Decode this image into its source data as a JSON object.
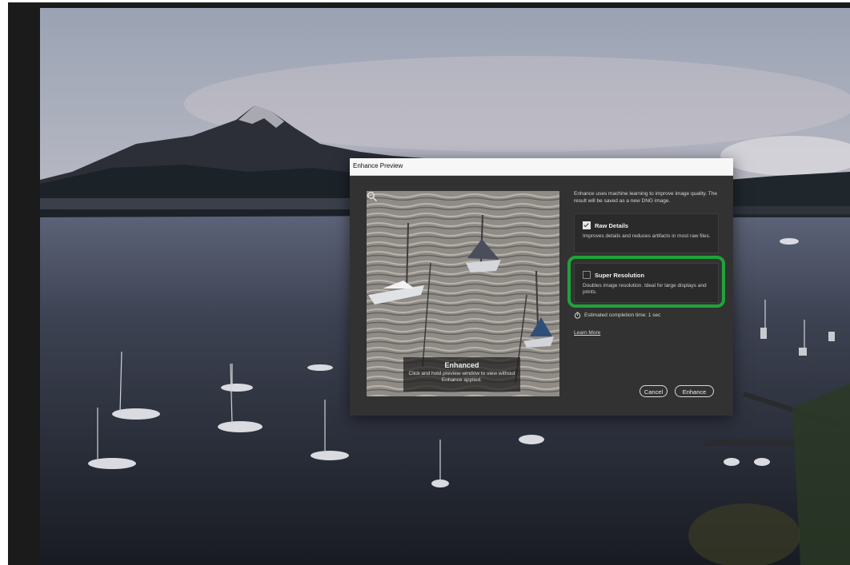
{
  "dialog": {
    "title": "Enhance Preview",
    "intro": "Enhance uses machine learning to improve image quality. The result will be saved as a new DNG image.",
    "preview": {
      "overlay_title": "Enhanced",
      "overlay_desc": "Click and hold preview window to view without Enhance applied."
    },
    "options": {
      "raw_details": {
        "label": "Raw Details",
        "description": "Improves details and reduces artifacts in most raw files.",
        "checked": true
      },
      "super_resolution": {
        "label": "Super Resolution",
        "description": "Doubles image resolution. Ideal for large displays and prints.",
        "checked": false
      }
    },
    "estimate": "Estimated completion time: 1 sec",
    "learn_more": "Learn More",
    "buttons": {
      "cancel": "Cancel",
      "enhance": "Enhance"
    }
  },
  "icons": {
    "raw_details_checkbox": "checkbox-checked-icon",
    "super_resolution_checkbox": "checkbox-empty-icon",
    "timer": "stopwatch-icon",
    "zoom": "magnifier-icon"
  },
  "colors": {
    "dialog_bg": "#323232",
    "titlebar_bg": "#f7f7f7",
    "highlight": "#1fa33a",
    "app_bg": "#1b1b1b"
  }
}
